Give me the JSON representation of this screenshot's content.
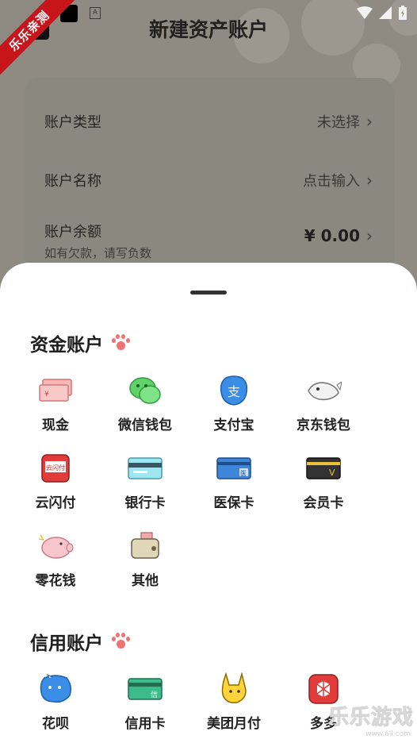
{
  "status_bar": {
    "badge_letter": "A"
  },
  "ribbon": {
    "text": "乐乐亲测"
  },
  "header": {
    "title": "新建资产账户"
  },
  "form": {
    "rows": [
      {
        "label": "账户类型",
        "value": "未选择",
        "sub": ""
      },
      {
        "label": "账户名称",
        "value": "点击输入",
        "sub": ""
      },
      {
        "label": "账户余额",
        "value": "¥ 0.00",
        "sub": "如有欠款，请写负数"
      }
    ]
  },
  "sheet": {
    "sections": [
      {
        "title": "资金账户",
        "items": [
          {
            "label": "现金",
            "icon": "cash-icon"
          },
          {
            "label": "微信钱包",
            "icon": "wechat-icon"
          },
          {
            "label": "支付宝",
            "icon": "alipay-icon"
          },
          {
            "label": "京东钱包",
            "icon": "jd-icon"
          },
          {
            "label": "云闪付",
            "icon": "unionpay-icon",
            "icon_text": "云闪付"
          },
          {
            "label": "银行卡",
            "icon": "bank-card-icon"
          },
          {
            "label": "医保卡",
            "icon": "medical-card-icon",
            "icon_text": "医"
          },
          {
            "label": "会员卡",
            "icon": "member-card-icon",
            "icon_text": "V"
          },
          {
            "label": "零花钱",
            "icon": "piggy-bank-icon"
          },
          {
            "label": "其他",
            "icon": "other-wallet-icon"
          }
        ]
      },
      {
        "title": "信用账户",
        "items": [
          {
            "label": "花呗",
            "icon": "huabei-icon"
          },
          {
            "label": "信用卡",
            "icon": "credit-card-icon",
            "icon_text": "信"
          },
          {
            "label": "美团月付",
            "icon": "meituan-icon"
          },
          {
            "label": "多多",
            "icon": "pinduoduo-icon"
          }
        ]
      }
    ]
  },
  "watermark": {
    "text": "乐乐游戏",
    "sub": "www.6ll.com"
  },
  "colors": {
    "accent_paw": "#f07272",
    "sheet_bg": "#ffffff",
    "dim_bg": "#8f8b82"
  }
}
